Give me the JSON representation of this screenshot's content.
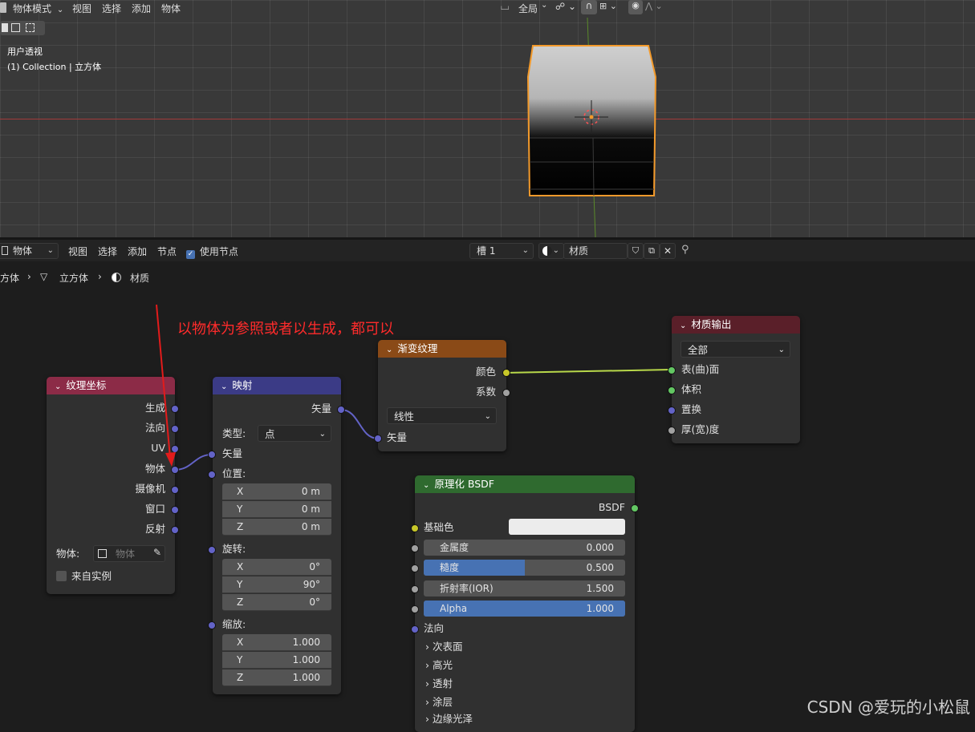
{
  "viewport": {
    "header": {
      "mode_label": "物体模式",
      "menus": [
        "视图",
        "选择",
        "添加",
        "物体"
      ],
      "transform_orientation": "全局"
    },
    "overlay": {
      "view_name": "用户透视",
      "collection_line": "(1) Collection | 立方体"
    }
  },
  "node_editor": {
    "header": {
      "editor_type": "物体",
      "menus": [
        "视图",
        "选择",
        "添加",
        "节点"
      ],
      "use_nodes_label": "使用节点",
      "slot_label": "槽 1",
      "material_name": "材质"
    },
    "breadcrumb": {
      "items": [
        "方体",
        "立方体",
        "材质"
      ]
    },
    "annotation": "以物体为参照或者以生成，都可以",
    "nodes": {
      "texcoord": {
        "title": "纹理坐标",
        "outputs": [
          "生成",
          "法向",
          "UV",
          "物体",
          "摄像机",
          "窗口",
          "反射"
        ],
        "object_label": "物体:",
        "object_placeholder": "物体",
        "from_instancer": "来自实例"
      },
      "mapping": {
        "title": "映射",
        "output": "矢量",
        "type_label": "类型:",
        "type_value": "点",
        "vector_input": "矢量",
        "location": {
          "label": "位置:",
          "x": "0 m",
          "y": "0 m",
          "z": "0 m"
        },
        "rotation": {
          "label": "旋转:",
          "x": "0°",
          "y": "90°",
          "z": "0°"
        },
        "scale": {
          "label": "缩放:",
          "x": "1.000",
          "y": "1.000",
          "z": "1.000"
        },
        "axes": [
          "X",
          "Y",
          "Z"
        ]
      },
      "gradient": {
        "title": "渐变纹理",
        "outputs": [
          "颜色",
          "系数"
        ],
        "type_value": "线性",
        "input": "矢量"
      },
      "bsdf": {
        "title": "原理化 BSDF",
        "output": "BSDF",
        "base_color_label": "基础色",
        "fields": [
          {
            "label": "金属度",
            "value": "0.000",
            "fill": 0.0
          },
          {
            "label": "糙度",
            "value": "0.500",
            "fill": 0.5
          },
          {
            "label": "折射率(IOR)",
            "value": "1.500",
            "fill": 0.0
          },
          {
            "label": "Alpha",
            "value": "1.000",
            "fill": 1.0
          }
        ],
        "normal_label": "法向",
        "panels": [
          "次表面",
          "高光",
          "透射",
          "涂层",
          "边缘光泽"
        ]
      },
      "output": {
        "title": "材质输出",
        "target": "全部",
        "inputs": [
          "表(曲)面",
          "体积",
          "置换",
          "厚(宽)度"
        ]
      }
    }
  },
  "watermark": "CSDN @爱玩的小松鼠"
}
